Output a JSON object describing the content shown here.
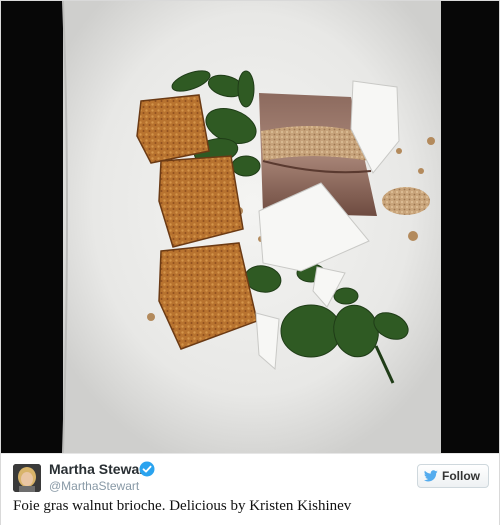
{
  "photo": {
    "icon": "food-photo-foie-gras-brioche"
  },
  "author": {
    "name": "Martha Stewart",
    "handle": "@MarthaStewart",
    "avatar_icon": "avatar-photo",
    "verified_icon": "verified-check-icon"
  },
  "follow": {
    "label": "Follow",
    "icon": "twitter-bird-icon",
    "color": "#55acee"
  },
  "tweet": {
    "text": "Foie gras walnut brioche. Delicious by Kristen Kishinev"
  }
}
